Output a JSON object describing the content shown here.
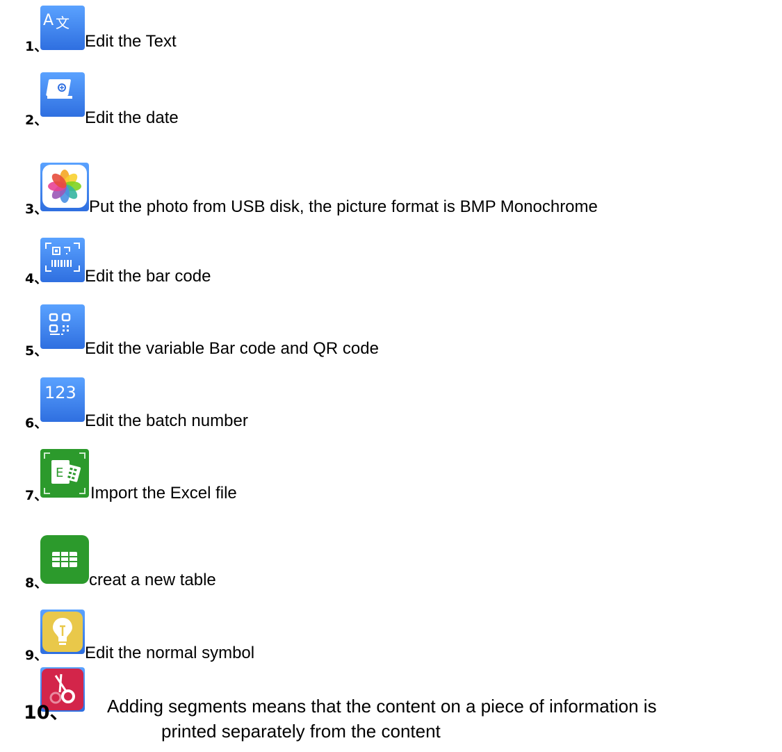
{
  "items": [
    {
      "number": "1、",
      "label": "Edit the Text",
      "icon": "translate-text-icon"
    },
    {
      "number": "2、",
      "label": "Edit the date",
      "icon": "calendar-date-icon"
    },
    {
      "number": "3、",
      "label": "Put the photo from USB disk, the picture format is BMP Monochrome",
      "icon": "photos-icon"
    },
    {
      "number": "4、",
      "label": "Edit the bar code",
      "icon": "barcode-scan-icon"
    },
    {
      "number": "5、",
      "label": "Edit the variable Bar code and QR code",
      "icon": "qr-code-icon"
    },
    {
      "number": "6、",
      "label": "Edit the batch number",
      "icon": "batch-number-icon"
    },
    {
      "number": "7、",
      "label": "Import the Excel file",
      "icon": "excel-import-icon"
    },
    {
      "number": "8、",
      "label": "creat a new table",
      "icon": "table-icon"
    },
    {
      "number": "9、",
      "label": "Edit the normal symbol",
      "icon": "lightbulb-symbol-icon"
    },
    {
      "number": "10、",
      "label_line1": "Adding segments means that the content on a piece of information is",
      "label_line2": "printed separately from the content",
      "icon": "scissors-segment-icon"
    }
  ],
  "colors": {
    "blue_icon": "#3d7ff0",
    "green_icon": "#2c9a2c",
    "yellow_icon": "#e9c84a",
    "red_icon": "#d3254a"
  }
}
